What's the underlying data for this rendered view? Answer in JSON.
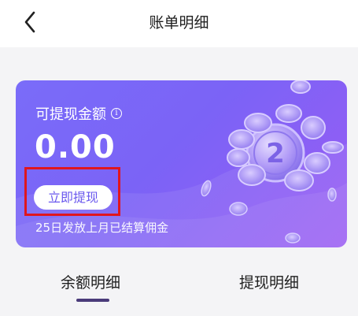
{
  "header": {
    "title": "账单明细",
    "back_icon": "chevron-left-icon"
  },
  "card": {
    "label": "可提现金额",
    "info_icon": "info-icon",
    "amount": "0.00",
    "withdraw_button": "立即提现",
    "note": "25日发放上月已结算佣金",
    "gradient_colors": [
      "#7a6cf9",
      "#9a5cf4"
    ],
    "highlight_color": "#e0161e",
    "illustration": "coins-illustration"
  },
  "tabs": [
    {
      "label": "余额明细",
      "selected": true
    },
    {
      "label": "提现明细",
      "selected": false
    }
  ]
}
